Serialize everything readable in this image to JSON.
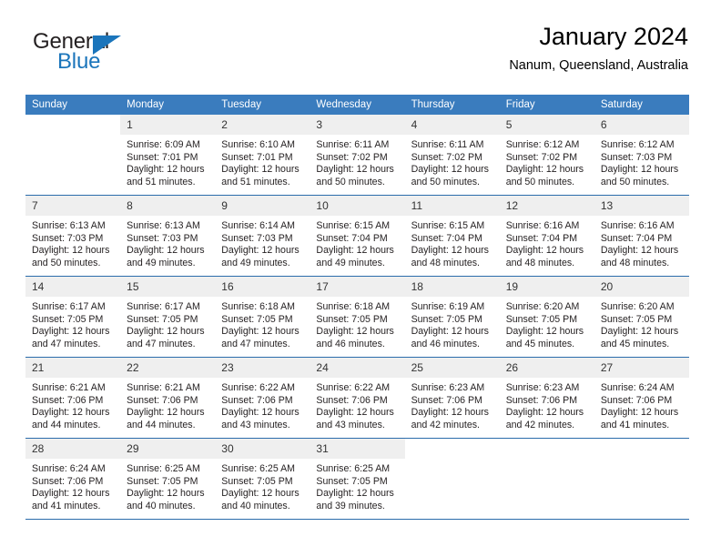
{
  "brand": {
    "name_top": "General",
    "name_bottom": "Blue",
    "triangle_color": "#1b75bb"
  },
  "header": {
    "title": "January 2024",
    "subtitle": "Nanum, Queensland, Australia"
  },
  "theme": {
    "header_bg": "#3a7cbe",
    "row_border": "#2b6cab",
    "daynum_bg": "#efefef",
    "text": "#231f20"
  },
  "weekday_headers": [
    "Sunday",
    "Monday",
    "Tuesday",
    "Wednesday",
    "Thursday",
    "Friday",
    "Saturday"
  ],
  "labels": {
    "sunrise_prefix": "Sunrise:",
    "sunset_prefix": "Sunset:",
    "daylight_prefix": "Daylight:"
  },
  "weeks": [
    [
      {
        "day": "",
        "l1": "",
        "l2": "",
        "l3": "",
        "l4": "",
        "blank": true
      },
      {
        "day": "1",
        "l1": "Sunrise: 6:09 AM",
        "l2": "Sunset: 7:01 PM",
        "l3": "Daylight: 12 hours",
        "l4": "and 51 minutes."
      },
      {
        "day": "2",
        "l1": "Sunrise: 6:10 AM",
        "l2": "Sunset: 7:01 PM",
        "l3": "Daylight: 12 hours",
        "l4": "and 51 minutes."
      },
      {
        "day": "3",
        "l1": "Sunrise: 6:11 AM",
        "l2": "Sunset: 7:02 PM",
        "l3": "Daylight: 12 hours",
        "l4": "and 50 minutes."
      },
      {
        "day": "4",
        "l1": "Sunrise: 6:11 AM",
        "l2": "Sunset: 7:02 PM",
        "l3": "Daylight: 12 hours",
        "l4": "and 50 minutes."
      },
      {
        "day": "5",
        "l1": "Sunrise: 6:12 AM",
        "l2": "Sunset: 7:02 PM",
        "l3": "Daylight: 12 hours",
        "l4": "and 50 minutes."
      },
      {
        "day": "6",
        "l1": "Sunrise: 6:12 AM",
        "l2": "Sunset: 7:03 PM",
        "l3": "Daylight: 12 hours",
        "l4": "and 50 minutes."
      }
    ],
    [
      {
        "day": "7",
        "l1": "Sunrise: 6:13 AM",
        "l2": "Sunset: 7:03 PM",
        "l3": "Daylight: 12 hours",
        "l4": "and 50 minutes."
      },
      {
        "day": "8",
        "l1": "Sunrise: 6:13 AM",
        "l2": "Sunset: 7:03 PM",
        "l3": "Daylight: 12 hours",
        "l4": "and 49 minutes."
      },
      {
        "day": "9",
        "l1": "Sunrise: 6:14 AM",
        "l2": "Sunset: 7:03 PM",
        "l3": "Daylight: 12 hours",
        "l4": "and 49 minutes."
      },
      {
        "day": "10",
        "l1": "Sunrise: 6:15 AM",
        "l2": "Sunset: 7:04 PM",
        "l3": "Daylight: 12 hours",
        "l4": "and 49 minutes."
      },
      {
        "day": "11",
        "l1": "Sunrise: 6:15 AM",
        "l2": "Sunset: 7:04 PM",
        "l3": "Daylight: 12 hours",
        "l4": "and 48 minutes."
      },
      {
        "day": "12",
        "l1": "Sunrise: 6:16 AM",
        "l2": "Sunset: 7:04 PM",
        "l3": "Daylight: 12 hours",
        "l4": "and 48 minutes."
      },
      {
        "day": "13",
        "l1": "Sunrise: 6:16 AM",
        "l2": "Sunset: 7:04 PM",
        "l3": "Daylight: 12 hours",
        "l4": "and 48 minutes."
      }
    ],
    [
      {
        "day": "14",
        "l1": "Sunrise: 6:17 AM",
        "l2": "Sunset: 7:05 PM",
        "l3": "Daylight: 12 hours",
        "l4": "and 47 minutes."
      },
      {
        "day": "15",
        "l1": "Sunrise: 6:17 AM",
        "l2": "Sunset: 7:05 PM",
        "l3": "Daylight: 12 hours",
        "l4": "and 47 minutes."
      },
      {
        "day": "16",
        "l1": "Sunrise: 6:18 AM",
        "l2": "Sunset: 7:05 PM",
        "l3": "Daylight: 12 hours",
        "l4": "and 47 minutes."
      },
      {
        "day": "17",
        "l1": "Sunrise: 6:18 AM",
        "l2": "Sunset: 7:05 PM",
        "l3": "Daylight: 12 hours",
        "l4": "and 46 minutes."
      },
      {
        "day": "18",
        "l1": "Sunrise: 6:19 AM",
        "l2": "Sunset: 7:05 PM",
        "l3": "Daylight: 12 hours",
        "l4": "and 46 minutes."
      },
      {
        "day": "19",
        "l1": "Sunrise: 6:20 AM",
        "l2": "Sunset: 7:05 PM",
        "l3": "Daylight: 12 hours",
        "l4": "and 45 minutes."
      },
      {
        "day": "20",
        "l1": "Sunrise: 6:20 AM",
        "l2": "Sunset: 7:05 PM",
        "l3": "Daylight: 12 hours",
        "l4": "and 45 minutes."
      }
    ],
    [
      {
        "day": "21",
        "l1": "Sunrise: 6:21 AM",
        "l2": "Sunset: 7:06 PM",
        "l3": "Daylight: 12 hours",
        "l4": "and 44 minutes."
      },
      {
        "day": "22",
        "l1": "Sunrise: 6:21 AM",
        "l2": "Sunset: 7:06 PM",
        "l3": "Daylight: 12 hours",
        "l4": "and 44 minutes."
      },
      {
        "day": "23",
        "l1": "Sunrise: 6:22 AM",
        "l2": "Sunset: 7:06 PM",
        "l3": "Daylight: 12 hours",
        "l4": "and 43 minutes."
      },
      {
        "day": "24",
        "l1": "Sunrise: 6:22 AM",
        "l2": "Sunset: 7:06 PM",
        "l3": "Daylight: 12 hours",
        "l4": "and 43 minutes."
      },
      {
        "day": "25",
        "l1": "Sunrise: 6:23 AM",
        "l2": "Sunset: 7:06 PM",
        "l3": "Daylight: 12 hours",
        "l4": "and 42 minutes."
      },
      {
        "day": "26",
        "l1": "Sunrise: 6:23 AM",
        "l2": "Sunset: 7:06 PM",
        "l3": "Daylight: 12 hours",
        "l4": "and 42 minutes."
      },
      {
        "day": "27",
        "l1": "Sunrise: 6:24 AM",
        "l2": "Sunset: 7:06 PM",
        "l3": "Daylight: 12 hours",
        "l4": "and 41 minutes."
      }
    ],
    [
      {
        "day": "28",
        "l1": "Sunrise: 6:24 AM",
        "l2": "Sunset: 7:06 PM",
        "l3": "Daylight: 12 hours",
        "l4": "and 41 minutes."
      },
      {
        "day": "29",
        "l1": "Sunrise: 6:25 AM",
        "l2": "Sunset: 7:05 PM",
        "l3": "Daylight: 12 hours",
        "l4": "and 40 minutes."
      },
      {
        "day": "30",
        "l1": "Sunrise: 6:25 AM",
        "l2": "Sunset: 7:05 PM",
        "l3": "Daylight: 12 hours",
        "l4": "and 40 minutes."
      },
      {
        "day": "31",
        "l1": "Sunrise: 6:25 AM",
        "l2": "Sunset: 7:05 PM",
        "l3": "Daylight: 12 hours",
        "l4": "and 39 minutes."
      },
      {
        "day": "",
        "l1": "",
        "l2": "",
        "l3": "",
        "l4": "",
        "blank": true
      },
      {
        "day": "",
        "l1": "",
        "l2": "",
        "l3": "",
        "l4": "",
        "blank": true
      },
      {
        "day": "",
        "l1": "",
        "l2": "",
        "l3": "",
        "l4": "",
        "blank": true
      }
    ]
  ]
}
